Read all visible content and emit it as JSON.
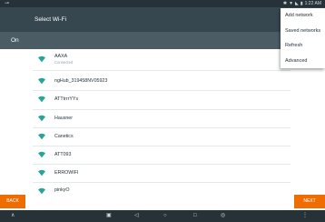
{
  "status_bar": {
    "left_glyph": "⊸",
    "icons": [
      "bluetooth-icon",
      "wifi-icon",
      "signal-icon",
      "battery-icon"
    ],
    "time": "1:22 AM"
  },
  "header": {
    "title": "Select Wi-Fi"
  },
  "wifi_switch": {
    "label": "On"
  },
  "overflow_menu": {
    "items": [
      {
        "label": "Add network"
      },
      {
        "label": "Saved networks"
      },
      {
        "label": "Refresh"
      },
      {
        "label": "Advanced"
      }
    ]
  },
  "networks": [
    {
      "name": "AAXA",
      "status": "Connected"
    },
    {
      "name": "ngHub_319458NV05923",
      "status": ""
    },
    {
      "name": "ATTtrrrYYs",
      "status": ""
    },
    {
      "name": "Hausner",
      "status": ""
    },
    {
      "name": "Canetics",
      "status": ""
    },
    {
      "name": "ATT093",
      "status": ""
    },
    {
      "name": "ERROWIFI",
      "status": ""
    },
    {
      "name": "pinkyO",
      "status": ""
    }
  ],
  "buttons": {
    "back": "BACK",
    "next": "NEXT"
  },
  "nav_bar": {
    "keys": [
      {
        "icon": "keyboard-hide-icon",
        "glyph": "∧"
      },
      {
        "icon": "camera-icon",
        "glyph": "▣"
      },
      {
        "icon": "back-icon",
        "glyph": "◁"
      },
      {
        "icon": "home-icon",
        "glyph": "○"
      },
      {
        "icon": "recents-icon",
        "glyph": "□"
      },
      {
        "icon": "screenshot-icon",
        "glyph": "◎"
      },
      {
        "icon": "more-icon",
        "glyph": "⋮"
      }
    ]
  },
  "colors": {
    "header": "#37474f",
    "switch_row": "#4b5c64",
    "accent_orange": "#ef6c00",
    "wifi_icon": "#26a69a"
  }
}
